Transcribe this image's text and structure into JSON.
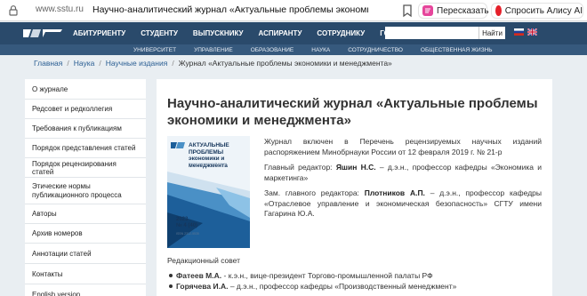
{
  "browser": {
    "url": "www.sstu.ru",
    "tab_title": "Научно-аналитический журнал «Актуальные проблемы экономики и ме...",
    "retell_label": "Пересказать",
    "alice_label": "Спросить Алису AI"
  },
  "topnav": {
    "items": [
      "АБИТУРИЕНТУ",
      "СТУДЕНТУ",
      "ВЫПУСКНИКУ",
      "АСПИРАНТУ",
      "СОТРУДНИКУ",
      "ГОСТЮ"
    ],
    "search_button": "Найти",
    "search_placeholder": ""
  },
  "subnav": {
    "items": [
      "УНИВЕРСИТЕТ",
      "УПРАВЛЕНИЕ",
      "ОБРАЗОВАНИЕ",
      "НАУКА",
      "СОТРУДНИЧЕСТВО",
      "ОБЩЕСТВЕННАЯ ЖИЗНЬ"
    ]
  },
  "breadcrumb": {
    "items": [
      "Главная",
      "Наука",
      "Научные издания"
    ],
    "current": "Журнал «Актуальные проблемы экономики и менеджмента»"
  },
  "sidebar": {
    "items": [
      "О журнале",
      "Редсовет и редколлегия",
      "Требования к публикациям",
      "Порядок представления статей",
      "Порядок рецензирования статей",
      "Этические нормы публикационного процесса",
      "Авторы",
      "Архив номеров",
      "Аннотации статей",
      "Контакты",
      "English version"
    ]
  },
  "main": {
    "title": "Научно-аналитический журнал «Актуальные проблемы экономики и менеджмента»",
    "cover": {
      "title": "АКТУАЛЬНЫЕ ПРОБЛЕМЫ экономики и менеджмента",
      "subtitle": "Научно-аналитический журнал",
      "year": "2023",
      "issue": "№ 4 (40)",
      "issn": "ISSN 2312-5535"
    },
    "para1": "Журнал включен в Перечень рецензируемых научных изданий распоряжением Минобрнауки России от 12 февраля 2019 г. № 21-р",
    "chief_label": "Главный редактор:",
    "chief_name": "Яшин Н.С.",
    "chief_desc": "– д.э.н., профессор кафедры «Экономика и маркетинга»",
    "deputy_label": "Зам. главного редактора:",
    "deputy_name": "Плотников А.П.",
    "deputy_desc": "– д.э.н., профессор кафедры «Отраслевое управление и экономическая безопасность» СГТУ имени Гагарина Ю.А.",
    "board_title": "Редакционный совет",
    "board": [
      {
        "name": "Фатеев М.А.",
        "desc": "- к.э.н., вице-президент Торгово-промышленной палаты РФ"
      },
      {
        "name": "Горячева И.А.",
        "desc": "– д.э.н., профессор кафедры «Производственный менеджмент»"
      }
    ]
  },
  "colors": {
    "topnav": "#2a4a6b",
    "subnav": "#36597d",
    "link": "#2a5e93",
    "background": "#e9eef2"
  },
  "icons": [
    "lock-icon",
    "bookmark-icon",
    "retell-icon",
    "alice-icon",
    "sstu-logo",
    "flag-ru-icon",
    "flag-en-icon"
  ]
}
